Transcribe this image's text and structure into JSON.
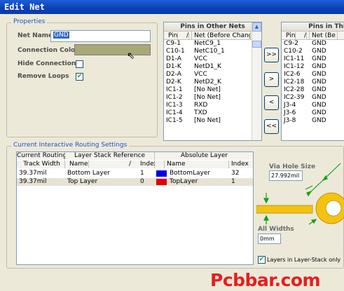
{
  "window": {
    "title": "Edit Net"
  },
  "properties": {
    "legend": "Properties",
    "net_name_label": "Net Name",
    "net_name_value": "GND",
    "connection_color_label": "Connection Color",
    "connection_color": "#a8a878",
    "hide_connections_label": "Hide Connections",
    "hide_connections_checked": false,
    "remove_loops_label": "Remove Loops",
    "remove_loops_checked": true
  },
  "other_nets": {
    "title": "Pins in Other Nets",
    "col_pin": "Pin",
    "col_sort": "/",
    "col_net": "Net (Before Change)",
    "rows": [
      {
        "pin": "C9-1",
        "net": "NetC9_1"
      },
      {
        "pin": "C10-1",
        "net": "NetC10_1"
      },
      {
        "pin": "D1-A",
        "net": "VCC"
      },
      {
        "pin": "D1-K",
        "net": "NetD1_K"
      },
      {
        "pin": "D2-A",
        "net": "VCC"
      },
      {
        "pin": "D2-K",
        "net": "NetD2_K"
      },
      {
        "pin": "IC1-1",
        "net": "[No Net]"
      },
      {
        "pin": "IC1-2",
        "net": "[No Net]"
      },
      {
        "pin": "IC1-3",
        "net": "RXD"
      },
      {
        "pin": "IC1-4",
        "net": "TXD"
      },
      {
        "pin": "IC1-5",
        "net": "[No Net]"
      }
    ]
  },
  "this_net": {
    "title": "Pins in Thi",
    "col_pin": "Pin",
    "col_sort": "/",
    "col_net": "Net (Be",
    "rows": [
      {
        "pin": "C9-2",
        "net": "GND"
      },
      {
        "pin": "C10-2",
        "net": "GND"
      },
      {
        "pin": "IC1-11",
        "net": "GND"
      },
      {
        "pin": "IC1-12",
        "net": "GND"
      },
      {
        "pin": "IC2-6",
        "net": "GND"
      },
      {
        "pin": "IC2-18",
        "net": "GND"
      },
      {
        "pin": "IC2-28",
        "net": "GND"
      },
      {
        "pin": "IC2-39",
        "net": "GND"
      },
      {
        "pin": "J3-4",
        "net": "GND"
      },
      {
        "pin": "J3-6",
        "net": "GND"
      },
      {
        "pin": "J3-8",
        "net": "GND"
      }
    ]
  },
  "transfer_buttons": {
    "add_all": ">>",
    "add": ">",
    "remove": "<",
    "remove_all": "<<"
  },
  "routing": {
    "legend": "Current Interactive Routing Settings",
    "group_current": "Current Routing",
    "group_stack": "Layer Stack Reference",
    "group_absolute": "Absolute Layer",
    "col_track_width": "Track Width",
    "col_name": "Name",
    "col_sort": "/",
    "col_index": "Index",
    "col_abs_name": "Name",
    "col_abs_index": "Index",
    "rows": [
      {
        "width": "39.37mil",
        "name": "Bottom Layer",
        "index": "1",
        "layer_color": "#0000e0",
        "abs_name": "BottomLayer",
        "abs_index": "32"
      },
      {
        "width": "39.37mil",
        "name": "Top Layer",
        "index": "0",
        "layer_color": "#e00000",
        "abs_name": "TopLayer",
        "abs_index": "1"
      }
    ],
    "via_hole_label": "Via Hole Size",
    "via_hole_value": "27.992mil",
    "all_widths_label": "All Widths",
    "all_widths_value": "0mm",
    "layers_in_stack_label": "Layers in Layer-Stack only",
    "layers_in_stack_checked": true
  },
  "watermark": "Pcbbar.com"
}
